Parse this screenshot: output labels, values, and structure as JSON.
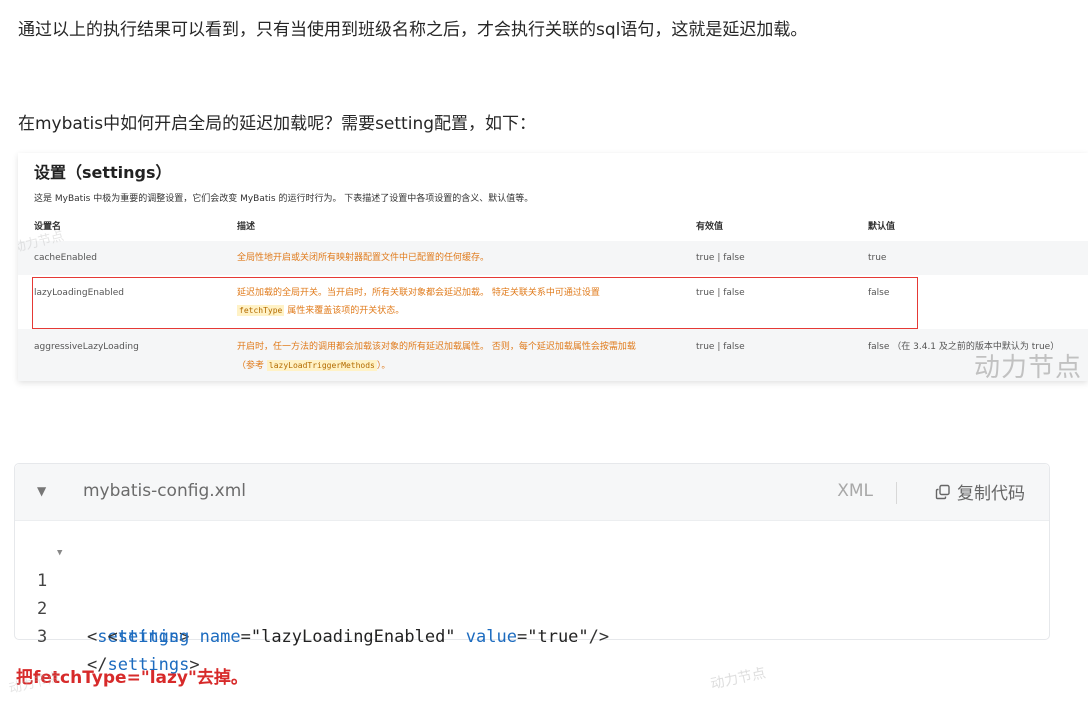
{
  "paragraphs": {
    "p1": "通过以上的执行结果可以看到，只有当使用到班级名称之后，才会执行关联的sql语句，这就是延迟加载。",
    "p2": "在mybatis中如何开启全局的延迟加载呢？需要setting配置，如下："
  },
  "settings_image": {
    "title": "设置（settings）",
    "description": "这是 MyBatis 中极为重要的调整设置，它们会改变 MyBatis 的运行时行为。 下表描述了设置中各项设置的含义、默认值等。",
    "headers": [
      "设置名",
      "描述",
      "有效值",
      "默认值"
    ],
    "rows": [
      {
        "name": "cacheEnabled",
        "desc1": "全局性地开启或关闭所有映射器配置文件中已配置的任何缓存。",
        "desc2": "",
        "valid": "true | false",
        "default": "true"
      },
      {
        "name": "lazyLoadingEnabled",
        "desc1": "延迟加载的全局开关。当开启时，所有关联对象都会延迟加载。 特定关联关系中可通过设置",
        "desc2_code": "fetchType",
        "desc2": " 属性来覆盖该项的开关状态。",
        "valid": "true | false",
        "default": "false"
      },
      {
        "name": "aggressiveLazyLoading",
        "desc1": "开启时，任一方法的调用都会加载该对象的所有延迟加载属性。 否则，每个延迟加载属性会按需加载",
        "desc2_pre": "（参考 ",
        "desc2_code": "lazyLoadTriggerMethods",
        "desc2": "）。",
        "valid": "true | false",
        "default": "false （在 3.4.1 及之前的版本中默认为 true）"
      }
    ],
    "watermark": "动力节点"
  },
  "code_block": {
    "filename": "mybatis-config.xml",
    "language": "XML",
    "copy_label": "复制代码",
    "lines": [
      {
        "num": "1",
        "text": "<settings>"
      },
      {
        "num": "2",
        "text": "  <setting name=\"lazyLoadingEnabled\" value=\"true\"/>"
      },
      {
        "num": "3",
        "text": "</settings>"
      }
    ]
  },
  "note": "把fetchType=\"lazy\"去掉。",
  "watermark": "动力节点",
  "colors": {
    "note": "#d72a2a",
    "highlight_box": "#e53935",
    "desc_text": "#e07b1c",
    "code_tag": "#1c6bbf"
  }
}
